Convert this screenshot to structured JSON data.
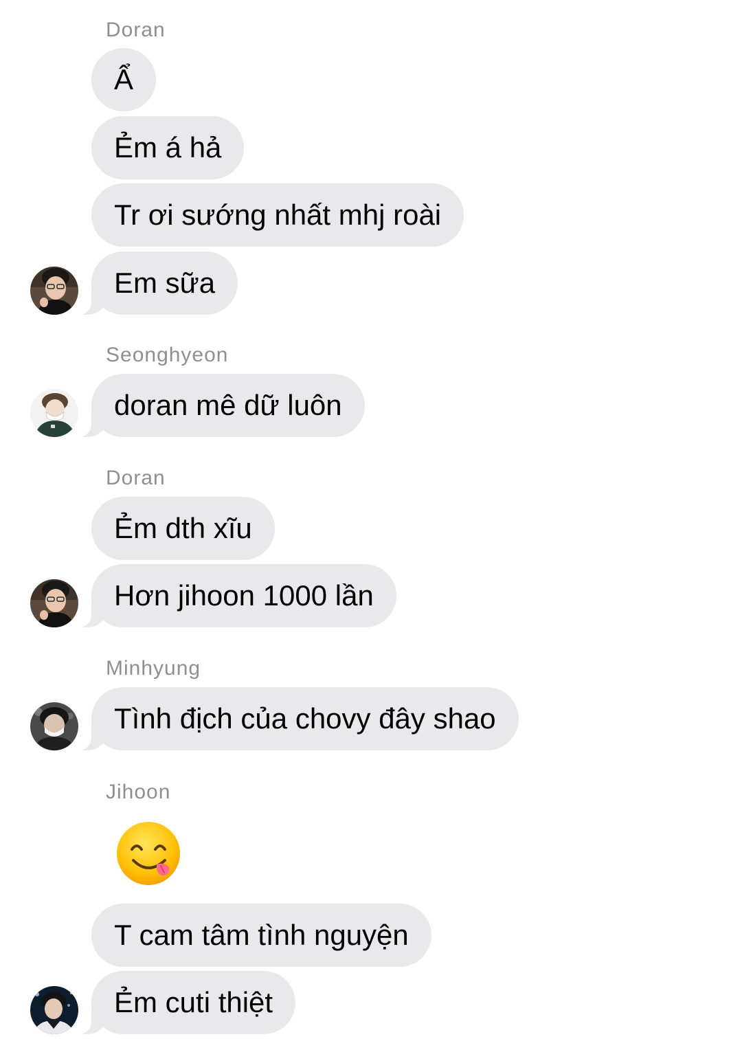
{
  "conversation": [
    {
      "sender": "Doran",
      "messages": [
        "Ẩ",
        "Ẻm á hả",
        "Tr ơi sướng nhất mhj roài",
        "Em sữa"
      ]
    },
    {
      "sender": "Seonghyeon",
      "messages": [
        "doran mê dữ luôn"
      ]
    },
    {
      "sender": "Doran",
      "messages": [
        "Ẻm dth xĩu",
        "Hơn jihoon 1000 lần"
      ]
    },
    {
      "sender": "Minhyung",
      "messages": [
        "Tình địch của chovy đây shao"
      ]
    },
    {
      "sender": "Jihoon",
      "messages": [
        "😋",
        "T cam tâm tình nguyện",
        "Ẻm cuti thiệt"
      ]
    }
  ],
  "emoji_name": "face-savoring-food",
  "colors": {
    "bubble": "#e9e9eb",
    "sender_name": "#8e8e93",
    "text": "#000000",
    "background": "#ffffff"
  }
}
